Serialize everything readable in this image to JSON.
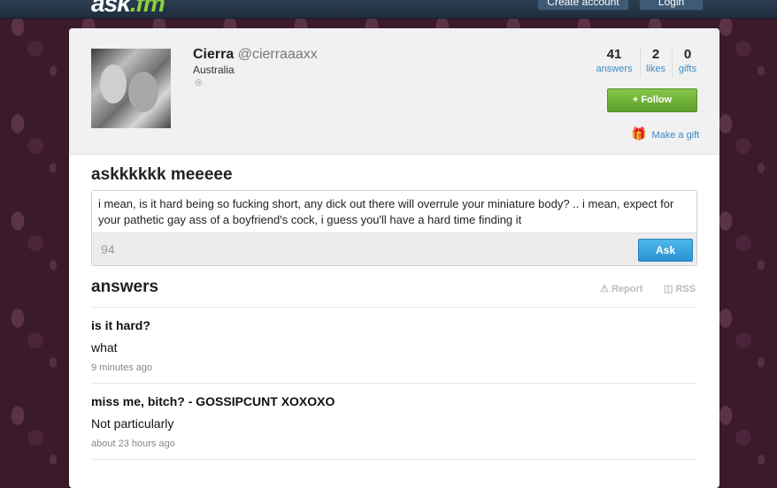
{
  "header": {
    "logo_main": "ask",
    "logo_ext": ".fm",
    "create_account": "Create account",
    "login": "Login"
  },
  "profile": {
    "name": "Cierra",
    "handle": "@cierraaaxx",
    "location": "Australia",
    "stats": [
      {
        "value": "41",
        "label": "answers"
      },
      {
        "value": "2",
        "label": "likes"
      },
      {
        "value": "0",
        "label": "gifts"
      }
    ],
    "follow_label": "+ Follow",
    "gift_label": "Make a gift"
  },
  "ask": {
    "title": "askkkkkk meeeee",
    "question_text": "i mean, is it hard being so fucking short, any dick out there will overrule your miniature body? .. i mean, expect for your pathetic gay ass of a boyfriend's cock, i guess you'll have a hard time finding it",
    "char_count": "94",
    "ask_button": "Ask"
  },
  "answers": {
    "title": "answers",
    "report_label": "Report",
    "rss_label": "RSS",
    "items": [
      {
        "question": "is it hard?",
        "answer": "what",
        "time": "9 minutes ago"
      },
      {
        "question": "miss me, bitch? - GOSSIPCUNT XOXOXO",
        "answer": "Not particularly",
        "time": "about 23 hours ago"
      }
    ]
  }
}
